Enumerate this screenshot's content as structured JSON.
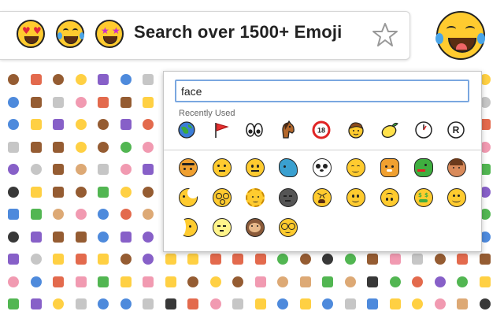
{
  "banner": {
    "title": "Search over 1500+ Emoji",
    "emojis": [
      "heart-eyes-emoji-icon",
      "tears-of-joy-emoji-icon",
      "star-struck-emoji-icon"
    ],
    "bookmark_icon": "star-outline-icon",
    "logo_icon": "tears-of-joy-emoji-icon"
  },
  "picker": {
    "search": {
      "value": "face",
      "placeholder": ""
    },
    "recent_label": "Recently Used",
    "recent_items": [
      {
        "name": "globe-icon"
      },
      {
        "name": "red-flag-icon"
      },
      {
        "name": "eyes-icon"
      },
      {
        "name": "horse-face-icon"
      },
      {
        "name": "no-under-18-icon"
      },
      {
        "name": "boy-face-icon"
      },
      {
        "name": "lemon-icon"
      },
      {
        "name": "one-oclock-icon"
      },
      {
        "name": "registered-sign-icon"
      }
    ],
    "results": [
      {
        "name": "tiger-face-icon"
      },
      {
        "name": "thinking-face-icon"
      },
      {
        "name": "neutral-face-icon"
      },
      {
        "name": "whale-face-icon"
      },
      {
        "name": "panda-face-icon"
      },
      {
        "name": "smiling-face-with-hand-icon"
      },
      {
        "name": "cat-face-icon"
      },
      {
        "name": "dragon-face-icon"
      },
      {
        "name": "woman-face-icon"
      },
      {
        "name": "crescent-moon-face-icon"
      },
      {
        "name": "dizzy-face-icon"
      },
      {
        "name": "sun-face-icon"
      },
      {
        "name": "new-moon-face-icon"
      },
      {
        "name": "tired-face-icon"
      },
      {
        "name": "slightly-smiling-face-icon"
      },
      {
        "name": "upside-down-face-icon"
      },
      {
        "name": "money-mouth-face-icon"
      },
      {
        "name": "smiling-face-icon"
      },
      {
        "name": "last-quarter-moon-face-icon"
      },
      {
        "name": "full-moon-face-icon"
      },
      {
        "name": "monkey-face-icon"
      },
      {
        "name": "nerd-face-icon"
      }
    ]
  },
  "colors": {
    "emoji_yellow": "#ffcb2f",
    "search_border": "#7aa7e0",
    "outline": "#222222"
  }
}
